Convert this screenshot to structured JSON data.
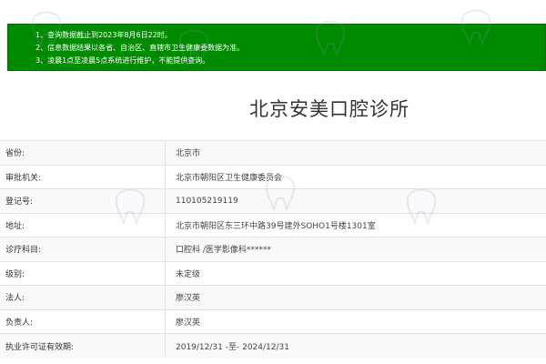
{
  "notice": {
    "lines": [
      "1、查询数据截止到2023年8月6日22时。",
      "2、信息数据结果以各省、自治区、直辖市卫生健康委数据为准。",
      "3、凌晨1点至凌晨5点系统进行维护，不能提供查询。"
    ]
  },
  "page_title": "北京安美口腔诊所",
  "info_rows": [
    {
      "label": "省份:",
      "value": "北京市"
    },
    {
      "label": "审批机关:",
      "value": "北京市朝阳区卫生健康委员会"
    },
    {
      "label": "登记号:",
      "value": "110105219119"
    },
    {
      "label": "地址:",
      "value": "北京市朝阳区东三环中路39号建外SOHO1号楼1301室"
    },
    {
      "label": "诊疗科目:",
      "value": "口腔科 /医学影像科******"
    },
    {
      "label": "级别:",
      "value": "未定级"
    },
    {
      "label": "法人:",
      "value": "廖汉英"
    },
    {
      "label": "负责人:",
      "value": "廖汉英"
    },
    {
      "label": "执业许可证有效期:",
      "value": "2019/12/31 -至- 2024/12/31"
    }
  ],
  "colors": {
    "notice_bg": "#008a00",
    "row_alt": "#f9f9f9",
    "border": "#e3e3e3"
  },
  "icons": {
    "watermark": "tooth-logo-icon"
  }
}
